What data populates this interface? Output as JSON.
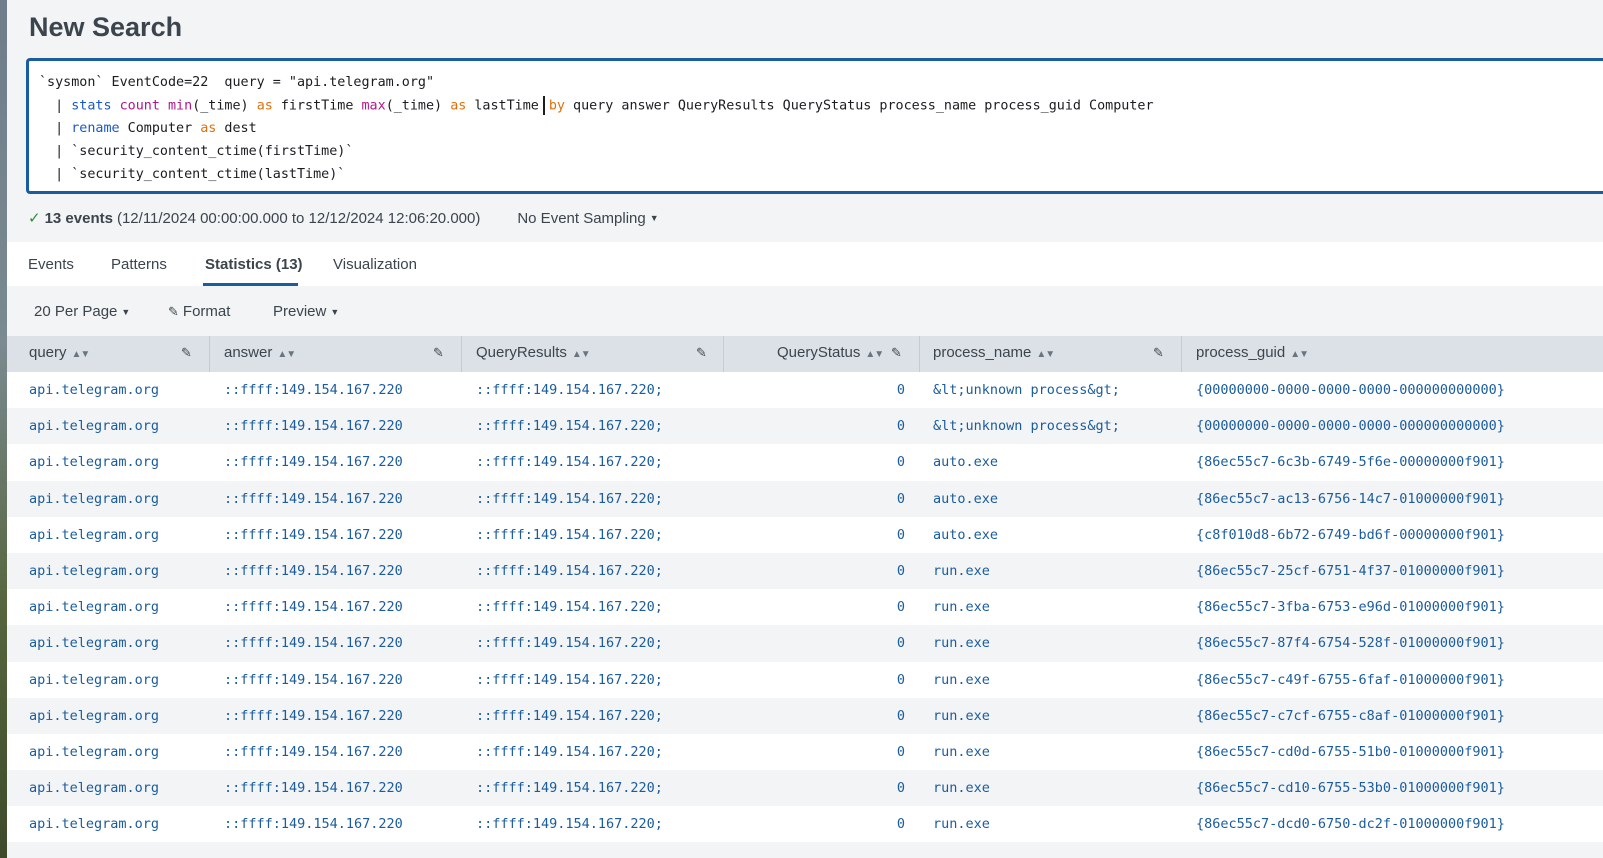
{
  "page": {
    "title": "New Search"
  },
  "search": {
    "lines": [
      [
        {
          "t": "`sysmon` EventCode=22  query = \"api.telegram.org\"",
          "c": ""
        }
      ],
      [
        {
          "t": "  | ",
          "c": ""
        },
        {
          "t": "stats",
          "c": "kw-blue"
        },
        {
          "t": " ",
          "c": ""
        },
        {
          "t": "count",
          "c": "kw-purple"
        },
        {
          "t": " ",
          "c": ""
        },
        {
          "t": "min",
          "c": "kw-purple"
        },
        {
          "t": "(_time) ",
          "c": ""
        },
        {
          "t": "as",
          "c": "kw-orange"
        },
        {
          "t": " firstTime ",
          "c": ""
        },
        {
          "t": "max",
          "c": "kw-purple"
        },
        {
          "t": "(_time) ",
          "c": ""
        },
        {
          "t": "as",
          "c": "kw-orange"
        },
        {
          "t": " lastTime",
          "c": ""
        },
        {
          "t": "",
          "c": "cursor"
        },
        {
          "t": "by",
          "c": "kw-orange"
        },
        {
          "t": " query answer QueryResults QueryStatus process_name process_guid Computer",
          "c": ""
        }
      ],
      [
        {
          "t": "  | ",
          "c": ""
        },
        {
          "t": "rename",
          "c": "kw-blue"
        },
        {
          "t": " Computer ",
          "c": ""
        },
        {
          "t": "as",
          "c": "kw-orange"
        },
        {
          "t": " dest",
          "c": ""
        }
      ],
      [
        {
          "t": "  | `security_content_ctime(firstTime)`",
          "c": ""
        }
      ],
      [
        {
          "t": "  | `security_content_ctime(lastTime)`",
          "c": ""
        }
      ]
    ]
  },
  "status": {
    "check_icon": "check-icon",
    "events_count": "13 events",
    "time_range": "(12/11/2024 00:00:00.000 to 12/12/2024 12:06:20.000)",
    "sampling": "No Event Sampling"
  },
  "tabs": [
    "Events",
    "Patterns",
    "Statistics (13)",
    "Visualization"
  ],
  "active_tab": "Statistics (13)",
  "toolbar": {
    "per_page": "20 Per Page",
    "format": "Format",
    "preview": "Preview"
  },
  "table": {
    "columns": [
      "query",
      "answer",
      "QueryResults",
      "QueryStatus",
      "process_name",
      "process_guid"
    ],
    "rows": [
      [
        "api.telegram.org",
        "::ffff:149.154.167.220",
        "::ffff:149.154.167.220;",
        "0",
        "&lt;unknown process&gt;",
        "{00000000-0000-0000-0000-000000000000}"
      ],
      [
        "api.telegram.org",
        "::ffff:149.154.167.220",
        "::ffff:149.154.167.220;",
        "0",
        "&lt;unknown process&gt;",
        "{00000000-0000-0000-0000-000000000000}"
      ],
      [
        "api.telegram.org",
        "::ffff:149.154.167.220",
        "::ffff:149.154.167.220;",
        "0",
        "auto.exe",
        "{86ec55c7-6c3b-6749-5f6e-00000000f901}"
      ],
      [
        "api.telegram.org",
        "::ffff:149.154.167.220",
        "::ffff:149.154.167.220;",
        "0",
        "auto.exe",
        "{86ec55c7-ac13-6756-14c7-01000000f901}"
      ],
      [
        "api.telegram.org",
        "::ffff:149.154.167.220",
        "::ffff:149.154.167.220;",
        "0",
        "auto.exe",
        "{c8f010d8-6b72-6749-bd6f-00000000f901}"
      ],
      [
        "api.telegram.org",
        "::ffff:149.154.167.220",
        "::ffff:149.154.167.220;",
        "0",
        "run.exe",
        "{86ec55c7-25cf-6751-4f37-01000000f901}"
      ],
      [
        "api.telegram.org",
        "::ffff:149.154.167.220",
        "::ffff:149.154.167.220;",
        "0",
        "run.exe",
        "{86ec55c7-3fba-6753-e96d-01000000f901}"
      ],
      [
        "api.telegram.org",
        "::ffff:149.154.167.220",
        "::ffff:149.154.167.220;",
        "0",
        "run.exe",
        "{86ec55c7-87f4-6754-528f-01000000f901}"
      ],
      [
        "api.telegram.org",
        "::ffff:149.154.167.220",
        "::ffff:149.154.167.220;",
        "0",
        "run.exe",
        "{86ec55c7-c49f-6755-6faf-01000000f901}"
      ],
      [
        "api.telegram.org",
        "::ffff:149.154.167.220",
        "::ffff:149.154.167.220;",
        "0",
        "run.exe",
        "{86ec55c7-c7cf-6755-c8af-01000000f901}"
      ],
      [
        "api.telegram.org",
        "::ffff:149.154.167.220",
        "::ffff:149.154.167.220;",
        "0",
        "run.exe",
        "{86ec55c7-cd0d-6755-51b0-01000000f901}"
      ],
      [
        "api.telegram.org",
        "::ffff:149.154.167.220",
        "::ffff:149.154.167.220;",
        "0",
        "run.exe",
        "{86ec55c7-cd10-6755-53b0-01000000f901}"
      ],
      [
        "api.telegram.org",
        "::ffff:149.154.167.220",
        "::ffff:149.154.167.220;",
        "0",
        "run.exe",
        "{86ec55c7-dcd0-6750-dc2f-01000000f901}"
      ]
    ]
  },
  "colors": {
    "accent": "#1a5c9e",
    "link": "#1a5c9e",
    "success": "#2f8f3a"
  }
}
